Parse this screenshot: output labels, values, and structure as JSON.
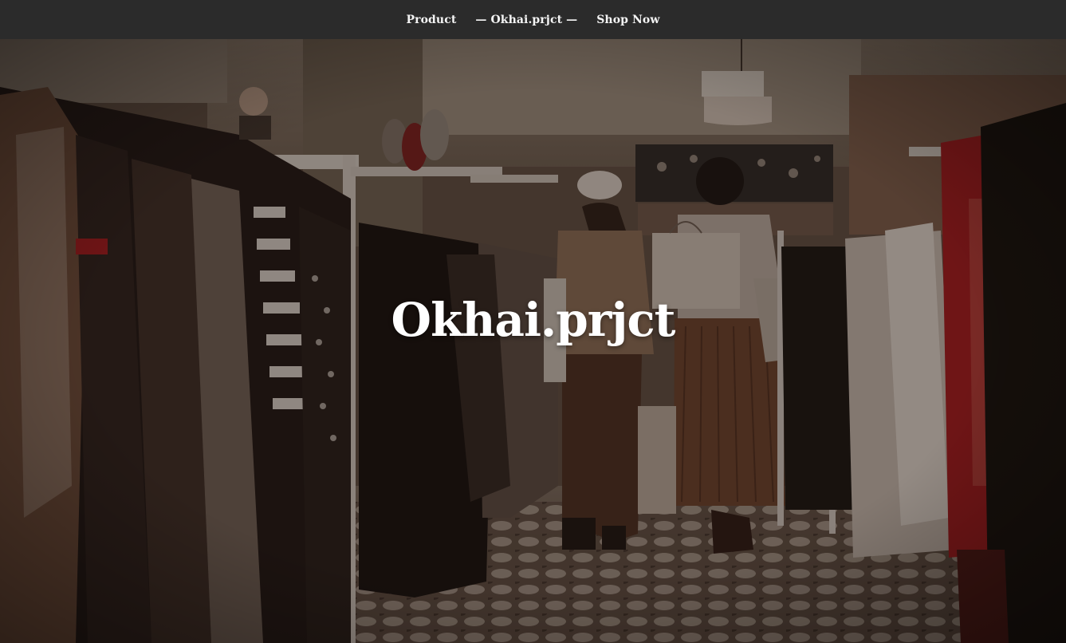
{
  "nav": {
    "items": [
      {
        "label": "Product"
      },
      {
        "label": "— Okhai.prjct —"
      },
      {
        "label": "Shop Now"
      }
    ]
  },
  "hero": {
    "title": "Okhai.prjct",
    "image": {
      "icon": "clothing-store-photo"
    },
    "overlay_color": "#1a120e"
  },
  "colors": {
    "navbar_bg": "#2b2b2b",
    "nav_text": "#f4f4f4",
    "hero_title": "#ffffff",
    "accent_red": "#a3181c"
  }
}
